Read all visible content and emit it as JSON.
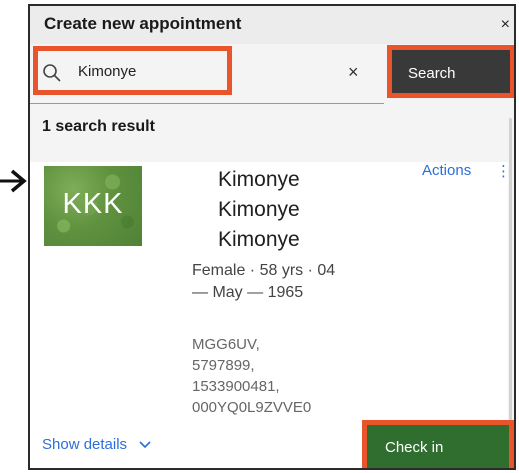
{
  "dialog": {
    "title": "Create new appointment",
    "close_label": "×"
  },
  "search": {
    "query": "Kimonye",
    "clear_label": "×",
    "button_label": "Search"
  },
  "results": {
    "count_label": "1 search result",
    "patient": {
      "initials": "KKK",
      "name_lines": [
        "Kimonye",
        "Kimonye",
        "Kimonye"
      ],
      "demographics": "Female · 58 yrs · 04 — May — 1965",
      "identifiers": [
        "MGG6UV,",
        "5797899,",
        "1533900481,",
        "000YQ0L9ZVVE0"
      ],
      "actions_label": "Actions",
      "overflow_label": "⋮",
      "show_details_label": "Show details",
      "checkin_label": "Check in"
    }
  },
  "colors": {
    "highlight": "#e9542a",
    "link": "#2d6fd8",
    "search_button": "#393939",
    "checkin_button": "#2f6e2f",
    "avatar_green": "#5f913f"
  },
  "icons": {
    "search": "search-icon",
    "close": "close-icon",
    "clear": "clear-icon",
    "chevron": "chevron-down-icon",
    "pointer": "arrow-right-icon"
  }
}
